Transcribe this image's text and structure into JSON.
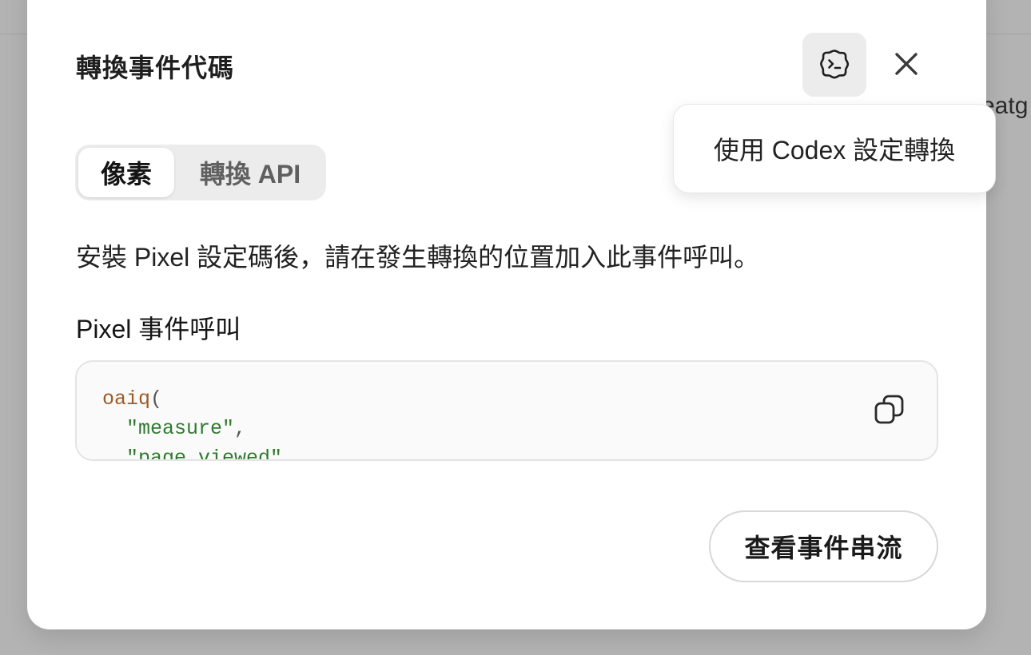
{
  "background": {
    "partial_text": "eatg"
  },
  "modal": {
    "title": "轉換事件代碼",
    "codex_button_icon": "codex-icon",
    "close_button_icon": "close-icon",
    "tooltip": "使用 Codex 設定轉換",
    "tabs": [
      {
        "label": "像素",
        "active": true
      },
      {
        "label": "轉換 API",
        "active": false
      }
    ],
    "description": "安裝 Pixel 設定碼後，請在發生轉換的位置加入此事件呼叫。",
    "section_label": "Pixel 事件呼叫",
    "code": {
      "fn": "oaiq",
      "open_paren": "(",
      "line2_string": "\"measure\"",
      "line2_comma": ",",
      "line3_string": "\"page_viewed\""
    },
    "copy_icon": "copy-icon",
    "event_stream_button": "查看事件串流"
  },
  "colors": {
    "overlay": "#b3b3b3",
    "modal_bg": "#ffffff",
    "code_fn": "#a05a22",
    "code_string": "#2f7a2f"
  }
}
